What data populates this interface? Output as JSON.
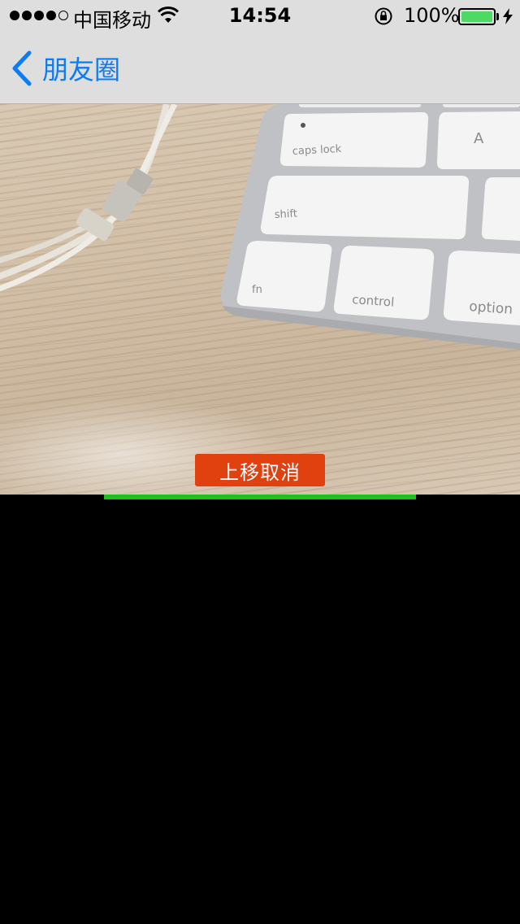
{
  "status_bar": {
    "carrier": "中国移动",
    "time": "14:54",
    "battery_percent": "100%",
    "signal_bars_filled": 4,
    "signal_bars_total": 5
  },
  "nav": {
    "back_label": "朋友圈"
  },
  "camera": {
    "keys": {
      "caps_lock": "caps lock",
      "a": "A",
      "shift": "shift",
      "fn": "fn",
      "control": "control",
      "option": "option"
    }
  },
  "recording": {
    "cancel_hint": "上移取消",
    "progress": 0.6,
    "progress_color": "#1ec01e",
    "hint_color": "#e0410f"
  },
  "colors": {
    "accent": "#0d7bf5",
    "bar_bg": "#dedede",
    "battery": "#4cd964"
  }
}
